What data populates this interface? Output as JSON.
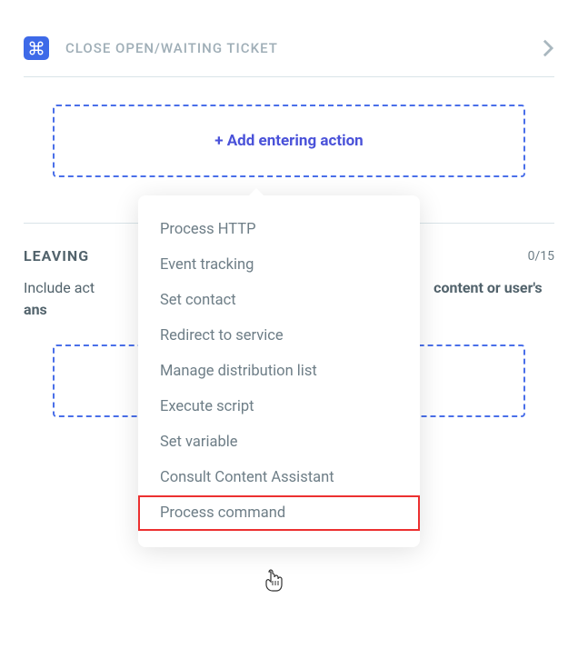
{
  "ticket": {
    "label": "CLOSE OPEN/WAITING TICKET"
  },
  "entering": {
    "add_label": "+ Add entering action"
  },
  "leaving": {
    "title": "LEAVING",
    "counter": "0/15",
    "description_prefix": "Include act",
    "description_bold_1": "content or user's ans"
  },
  "dropdown": {
    "items": [
      "Process HTTP",
      "Event tracking",
      "Set contact",
      "Redirect to service",
      "Manage distribution list",
      "Execute script",
      "Set variable",
      "Consult Content Assistant",
      "Process command"
    ]
  }
}
